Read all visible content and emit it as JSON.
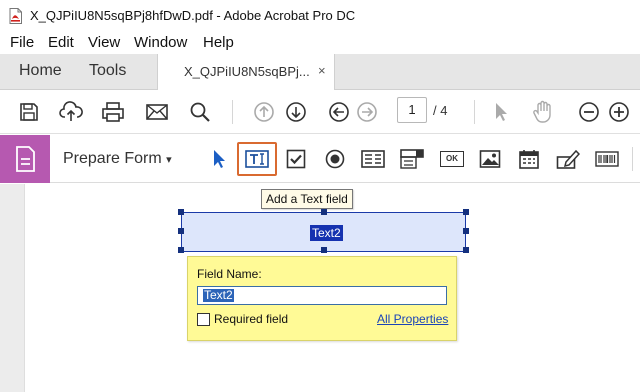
{
  "window": {
    "title": "X_QJPiIU8N5sqBPj8hfDwD.pdf - Adobe Acrobat Pro DC",
    "app_icon": "pdf-file-icon"
  },
  "menu": {
    "items": [
      "File",
      "Edit",
      "View",
      "Window",
      "Help"
    ]
  },
  "tabs": {
    "home": "Home",
    "tools": "Tools",
    "document": "X_QJPiIU8N5sqBPj...",
    "close": "×"
  },
  "toolbar": {
    "icons": [
      "save-icon",
      "cloud-upload-icon",
      "print-icon",
      "email-icon",
      "search-icon",
      "previous-page-icon",
      "next-page-icon",
      "back-icon",
      "forward-icon",
      "select-cursor-icon",
      "hand-tool-icon",
      "zoom-out-icon",
      "zoom-in-icon"
    ],
    "page_current": "1",
    "page_total": "/ 4"
  },
  "form_toolbar": {
    "label": "Prepare Form",
    "dropdown_arrow": "▾",
    "tools": [
      "select-object-icon",
      "text-field-icon",
      "checkbox-icon",
      "radio-button-icon",
      "list-box-icon",
      "dropdown-list-icon",
      "button-icon",
      "image-icon",
      "date-field-icon",
      "signature-field-icon",
      "barcode-icon"
    ],
    "button_text": "OK",
    "active_tool": "text-field-icon",
    "badge_color": "#b659b0",
    "highlight_color": "#d96a30"
  },
  "tooltip": {
    "text": "Add a Text field"
  },
  "field": {
    "name": "Text2"
  },
  "popover": {
    "title": "Field Name:",
    "input_value": "Text2",
    "required_label": "Required field",
    "required_checked": false,
    "all_properties_link": "All Properties"
  }
}
